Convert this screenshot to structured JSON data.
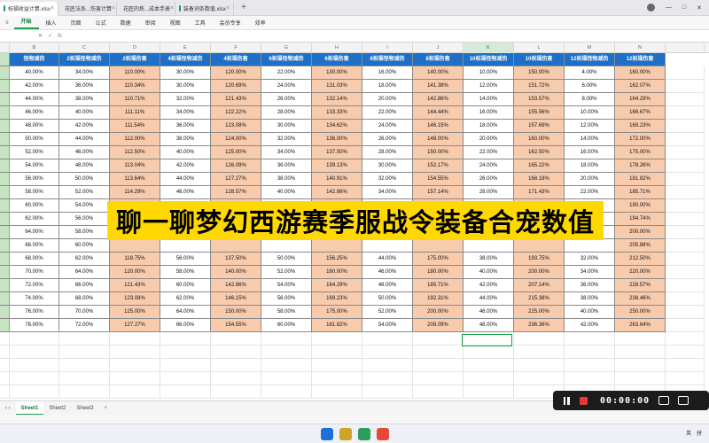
{
  "titlebar": {
    "tabs": [
      {
        "label": "祝福收益计算.xlsx",
        "icon_color": "#1b9e4b",
        "active": true
      },
      {
        "label": "花匠法系...伤害计算",
        "icon_color": "#1b9e4b",
        "active": false
      },
      {
        "label": "花匠的炼...成本手册",
        "icon_color": "#1b9e4b",
        "active": false
      },
      {
        "label": "装备词条数值.xlsx",
        "icon_color": "#1b9e4b",
        "active": false
      }
    ]
  },
  "menubar": {
    "items": [
      "开始",
      "插入",
      "页面",
      "公式",
      "数据",
      "审阅",
      "视图",
      "工具",
      "会员专享",
      "效率"
    ],
    "active": "开始"
  },
  "formula": {
    "name_box": "",
    "fx": "fx"
  },
  "columns": [
    "",
    "B",
    "C",
    "D",
    "E",
    "F",
    "G",
    "H",
    "I",
    "J",
    "K",
    "L",
    "M",
    "N",
    ""
  ],
  "selected_column": "K",
  "table": {
    "headers": [
      "怪物减伤",
      "2祝福怪物减伤",
      "2祝福伤害",
      "4祝福怪物减伤",
      "4祝福伤害",
      "6祝福怪物减伤",
      "6祝福伤害",
      "8祝福怪物减伤",
      "8祝福伤害",
      "10祝福怪物减伤",
      "10祝福伤害",
      "12祝福怪物减伤",
      "12祝福伤害"
    ],
    "rows": [
      [
        "40.00%",
        "34.00%",
        "110.00%",
        "30.00%",
        "120.00%",
        "22.00%",
        "130.00%",
        "16.00%",
        "140.00%",
        "10.00%",
        "150.00%",
        "4.00%",
        "160.00%"
      ],
      [
        "42.00%",
        "36.00%",
        "110.34%",
        "30.00%",
        "120.69%",
        "24.00%",
        "131.03%",
        "18.00%",
        "141.38%",
        "12.00%",
        "151.72%",
        "6.00%",
        "162.07%"
      ],
      [
        "44.00%",
        "38.00%",
        "110.71%",
        "32.00%",
        "121.43%",
        "26.00%",
        "132.14%",
        "20.00%",
        "142.86%",
        "14.00%",
        "153.57%",
        "8.00%",
        "164.29%"
      ],
      [
        "46.00%",
        "40.00%",
        "111.11%",
        "34.00%",
        "122.22%",
        "28.00%",
        "133.33%",
        "22.00%",
        "144.44%",
        "16.00%",
        "155.56%",
        "10.00%",
        "166.67%"
      ],
      [
        "48.00%",
        "42.00%",
        "111.54%",
        "36.00%",
        "123.08%",
        "30.00%",
        "134.62%",
        "24.00%",
        "146.15%",
        "18.00%",
        "157.69%",
        "12.00%",
        "169.23%"
      ],
      [
        "50.00%",
        "44.00%",
        "112.00%",
        "38.00%",
        "124.00%",
        "32.00%",
        "136.00%",
        "26.00%",
        "148.00%",
        "20.00%",
        "160.00%",
        "14.00%",
        "172.00%"
      ],
      [
        "52.00%",
        "46.00%",
        "112.50%",
        "40.00%",
        "125.00%",
        "34.00%",
        "137.50%",
        "28.00%",
        "150.00%",
        "22.00%",
        "162.50%",
        "16.00%",
        "175.00%"
      ],
      [
        "54.00%",
        "48.00%",
        "113.04%",
        "42.00%",
        "126.09%",
        "36.00%",
        "139.13%",
        "30.00%",
        "152.17%",
        "24.00%",
        "165.22%",
        "18.00%",
        "178.26%"
      ],
      [
        "56.00%",
        "50.00%",
        "113.64%",
        "44.00%",
        "127.27%",
        "38.00%",
        "140.91%",
        "32.00%",
        "154.55%",
        "26.00%",
        "168.18%",
        "20.00%",
        "181.82%"
      ],
      [
        "58.00%",
        "52.00%",
        "114.29%",
        "46.00%",
        "128.57%",
        "40.00%",
        "142.86%",
        "34.00%",
        "157.14%",
        "28.00%",
        "171.43%",
        "22.00%",
        "185.71%"
      ],
      [
        "60.00%",
        "54.00%",
        "115.00%",
        "48.00%",
        "130.00%",
        "42.00%",
        "145.00%",
        "36.00%",
        "160.00%",
        "30.00%",
        "175.00%",
        "24.00%",
        "190.00%"
      ],
      [
        "62.00%",
        "56.00%",
        "",
        "",
        "",
        "",
        "",
        "",
        "",
        "",
        "",
        "",
        "194.74%"
      ],
      [
        "64.00%",
        "58.00%",
        "",
        "",
        "",
        "",
        "",
        "",
        "",
        "",
        "",
        "",
        "200.00%"
      ],
      [
        "66.00%",
        "60.00%",
        "",
        "",
        "",
        "",
        "",
        "",
        "",
        "",
        "",
        "",
        "205.88%"
      ],
      [
        "68.00%",
        "62.00%",
        "118.75%",
        "56.00%",
        "137.50%",
        "50.00%",
        "156.25%",
        "44.00%",
        "175.00%",
        "38.00%",
        "193.75%",
        "32.00%",
        "212.50%"
      ],
      [
        "70.00%",
        "64.00%",
        "120.00%",
        "58.00%",
        "140.00%",
        "52.00%",
        "160.00%",
        "46.00%",
        "180.00%",
        "40.00%",
        "200.00%",
        "34.00%",
        "220.00%"
      ],
      [
        "72.00%",
        "66.00%",
        "121.43%",
        "60.00%",
        "142.86%",
        "54.00%",
        "164.29%",
        "48.00%",
        "185.71%",
        "42.00%",
        "207.14%",
        "36.00%",
        "228.57%"
      ],
      [
        "74.00%",
        "68.00%",
        "123.08%",
        "62.00%",
        "146.15%",
        "56.00%",
        "169.23%",
        "50.00%",
        "192.31%",
        "44.00%",
        "215.38%",
        "38.00%",
        "238.46%"
      ],
      [
        "76.00%",
        "70.00%",
        "125.00%",
        "64.00%",
        "150.00%",
        "58.00%",
        "175.00%",
        "52.00%",
        "200.00%",
        "46.00%",
        "225.00%",
        "40.00%",
        "250.00%"
      ],
      [
        "78.00%",
        "72.00%",
        "127.27%",
        "66.00%",
        "154.55%",
        "60.00%",
        "181.82%",
        "54.00%",
        "209.09%",
        "48.00%",
        "236.36%",
        "42.00%",
        "263.64%"
      ]
    ],
    "header_color": "#1d6fc7",
    "damage_color": "#f8cbad"
  },
  "banner": {
    "text": "聊一聊梦幻西游赛季服战令装备合宠数值",
    "color": "#ffd800"
  },
  "sheets": {
    "tabs": [
      "Sheet1",
      "Sheet2",
      "Sheet3"
    ],
    "active": "Sheet1",
    "add": "+"
  },
  "recorder": {
    "time": "00:00:00"
  },
  "taskbar": {
    "lang": "英",
    "ime": "拼"
  }
}
